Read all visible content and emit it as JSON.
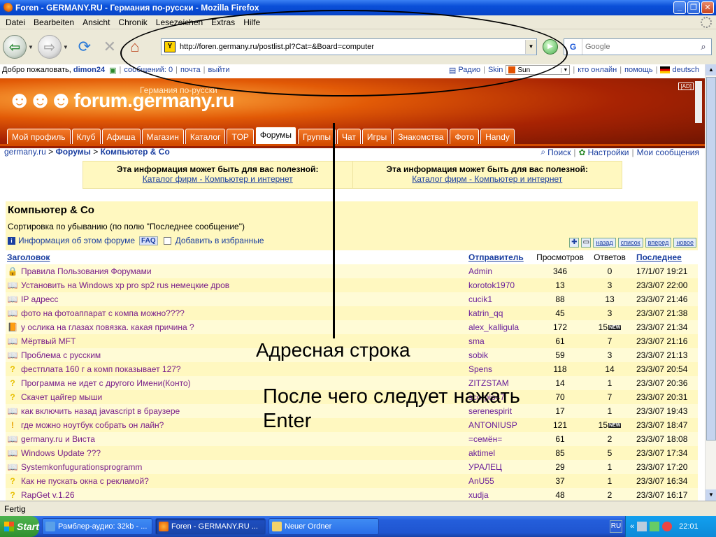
{
  "window": {
    "title": "Foren - GERMANY.RU - Германия по-русски - Mozilla Firefox"
  },
  "menu": [
    "Datei",
    "Bearbeiten",
    "Ansicht",
    "Chronik",
    "Lesezeichen",
    "Extras",
    "Hilfe"
  ],
  "nav": {
    "url": "http://foren.germany.ru/postlist.pl?Cat=&Board=computer",
    "search_placeholder": "Google"
  },
  "userbar": {
    "welcome": "Добро пожаловать,",
    "username": "dimon24",
    "messages": "сообщений: 0",
    "mail": "почта",
    "logout": "выйти",
    "radio": "Радио",
    "skin_label": "Skin",
    "skin_value": "Sun",
    "online": "кто онлайн",
    "help": "помощь",
    "language": "deutsch"
  },
  "banner": {
    "site_name": "forum.germany.ru",
    "tagline": "Германия по-русски",
    "ad_label": "[AD]"
  },
  "tabs": [
    {
      "label": "Мой профиль",
      "active": false
    },
    {
      "label": "Клуб",
      "active": false
    },
    {
      "label": "Афиша",
      "active": false
    },
    {
      "label": "Магазин",
      "active": false
    },
    {
      "label": "Каталог",
      "active": false
    },
    {
      "label": "TOP",
      "active": false
    },
    {
      "label": "Форумы",
      "active": true
    },
    {
      "label": "Группы",
      "active": false
    },
    {
      "label": "Чат",
      "active": false
    },
    {
      "label": "Игры",
      "active": false
    },
    {
      "label": "Знакомства",
      "active": false
    },
    {
      "label": "Фото",
      "active": false
    },
    {
      "label": "Handy",
      "active": false
    }
  ],
  "breadcrumb": {
    "root": "germany.ru",
    "sep1": ">",
    "forums": "Форумы",
    "sep2": ">",
    "current": "Компьютер & Co"
  },
  "toplinks": {
    "search": "Поиск",
    "settings": "Настройки",
    "my_messages": "Мои сообщения"
  },
  "info": [
    {
      "heading": "Эта информация может быть для вас полезной:",
      "link": "Каталог фирм - Компьютер и интернет"
    },
    {
      "heading": "Эта информация может быть для вас полезной:",
      "link": "Каталог фирм - Компьютер и интернет"
    }
  ],
  "forum": {
    "title": "Компьютер & Co",
    "sort_text": "Сортировка по убыванию (по полю \"Последнее сообщение\")",
    "info_link": "Информация об этом форуме",
    "faq": "FAQ",
    "favorite_link": "Добавить в избранные",
    "nav_back": "назад",
    "nav_list": "список",
    "nav_forward": "вперед",
    "nav_new": "новое",
    "columns": {
      "title": "Заголовок",
      "sender": "Отправитель",
      "views": "Просмотров",
      "replies": "Ответов",
      "last": "Последнее"
    },
    "new_badge": "NEW",
    "threads": [
      {
        "icon": "lock",
        "title": "Правила Пользования Форумами",
        "sender": "Admin",
        "views": "346",
        "replies": "0",
        "new": false,
        "last": "17/1/07 19:21"
      },
      {
        "icon": "book",
        "title": "Установить на Windows xp pro sp2 rus немецкие дров",
        "sender": "korotok1970",
        "views": "13",
        "replies": "3",
        "new": false,
        "last": "23/3/07 22:00"
      },
      {
        "icon": "book",
        "title": "IP адресс",
        "sender": "cucik1",
        "views": "88",
        "replies": "13",
        "new": false,
        "last": "23/3/07 21:46"
      },
      {
        "icon": "book",
        "title": "фото на фотоаппарат с компа можно????",
        "sender": "katrin_qq",
        "views": "45",
        "replies": "3",
        "new": false,
        "last": "23/3/07 21:38"
      },
      {
        "icon": "book-hot",
        "title": "у ослика на глазах повязка. какая причина ?",
        "sender": "alex_kalligula",
        "views": "172",
        "replies": "15",
        "new": true,
        "last": "23/3/07 21:34"
      },
      {
        "icon": "book",
        "title": "Мёртвый MFT",
        "sender": "sma",
        "views": "61",
        "replies": "7",
        "new": false,
        "last": "23/3/07 21:16"
      },
      {
        "icon": "book",
        "title": "Проблема с русским",
        "sender": "sobik",
        "views": "59",
        "replies": "3",
        "new": false,
        "last": "23/3/07 21:13"
      },
      {
        "icon": "question",
        "title": "фестплата 160 г а комп показывает 127?",
        "sender": "Spens",
        "views": "118",
        "replies": "14",
        "new": false,
        "last": "23/3/07 20:54"
      },
      {
        "icon": "question",
        "title": "Программа не идет с другого Имени(Конто)",
        "sender": "ZITZSTAM",
        "views": "14",
        "replies": "1",
        "new": false,
        "last": "23/3/07 20:36"
      },
      {
        "icon": "question",
        "title": "Скачет цайгер мыши",
        "sender": "scorpio47",
        "views": "70",
        "replies": "7",
        "new": false,
        "last": "23/3/07 20:31"
      },
      {
        "icon": "book",
        "title": "как включить назад javascript в браузере",
        "sender": "serenespirit",
        "views": "17",
        "replies": "1",
        "new": false,
        "last": "23/3/07 19:43"
      },
      {
        "icon": "exclaim",
        "title": "где можно ноутбук собрать он лайн?",
        "sender": "ANTONIUSP",
        "views": "121",
        "replies": "15",
        "new": true,
        "last": "23/3/07 18:47"
      },
      {
        "icon": "book",
        "title": "germany.ru и Виста",
        "sender": "=семён=",
        "views": "61",
        "replies": "2",
        "new": false,
        "last": "23/3/07 18:08"
      },
      {
        "icon": "book",
        "title": "Windows Update ???",
        "sender": "aktimel",
        "views": "85",
        "replies": "5",
        "new": false,
        "last": "23/3/07 17:34"
      },
      {
        "icon": "book",
        "title": "Systemkonfugurationsprogramm",
        "sender": "УРАЛЕЦ",
        "views": "29",
        "replies": "1",
        "new": false,
        "last": "23/3/07 17:20"
      },
      {
        "icon": "question",
        "title": "Как не пускать окна с рекламой?",
        "sender": "AnU55",
        "views": "37",
        "replies": "1",
        "new": false,
        "last": "23/3/07 16:34"
      },
      {
        "icon": "question",
        "title": "RapGet v.1.26",
        "sender": "xudja",
        "views": "48",
        "replies": "2",
        "new": false,
        "last": "23/3/07 16:17"
      }
    ]
  },
  "annotations": {
    "address_bar": "Адресная строка",
    "press_enter_line1": "После чего следует нажать",
    "press_enter_line2": "Enter"
  },
  "status": "Fertig",
  "taskbar": {
    "start": "Start",
    "tasks": [
      {
        "label": "Рамблер-аудио: 32kb - ...",
        "active": false
      },
      {
        "label": "Foren - GERMANY.RU ...",
        "active": true
      },
      {
        "label": "Neuer Ordner",
        "active": false
      }
    ],
    "lang": "RU",
    "clock": "22:01"
  }
}
